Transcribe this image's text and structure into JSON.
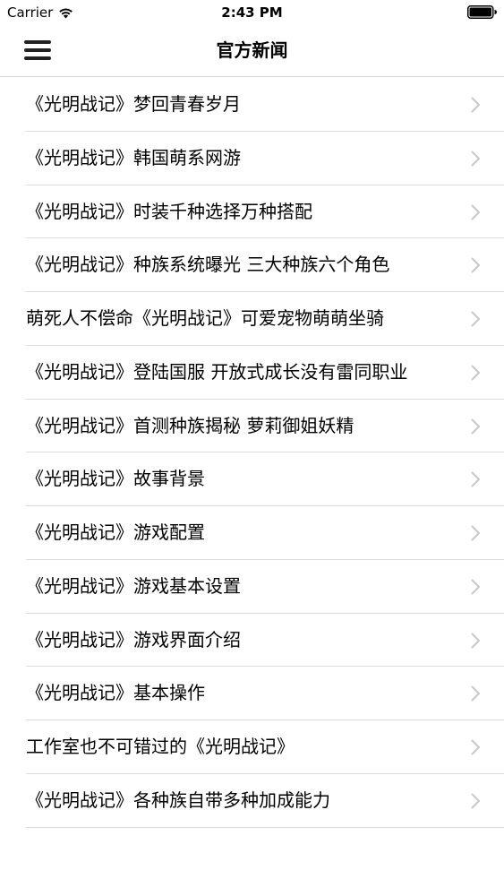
{
  "status_bar": {
    "carrier": "Carrier",
    "time": "2:43 PM"
  },
  "nav": {
    "title": "官方新闻",
    "menu_icon": "hamburger-menu-icon"
  },
  "news": [
    {
      "title": "《光明战记》梦回青春岁月"
    },
    {
      "title": "《光明战记》韩国萌系网游"
    },
    {
      "title": "《光明战记》时装千种选择万种搭配"
    },
    {
      "title": "《光明战记》种族系统曝光 三大种族六个角色"
    },
    {
      "title": "萌死人不偿命《光明战记》可爱宠物萌萌坐骑"
    },
    {
      "title": "《光明战记》登陆国服 开放式成长没有雷同职业"
    },
    {
      "title": "《光明战记》首测种族揭秘 萝莉御姐妖精"
    },
    {
      "title": "《光明战记》故事背景"
    },
    {
      "title": "《光明战记》游戏配置"
    },
    {
      "title": "《光明战记》游戏基本设置"
    },
    {
      "title": "《光明战记》游戏界面介绍"
    },
    {
      "title": "《光明战记》基本操作"
    },
    {
      "title": "工作室也不可错过的《光明战记》"
    },
    {
      "title": "《光明战记》各种族自带多种加成能力"
    }
  ],
  "colors": {
    "separator": "#dcdcdc",
    "chevron": "#c7c7cc"
  }
}
